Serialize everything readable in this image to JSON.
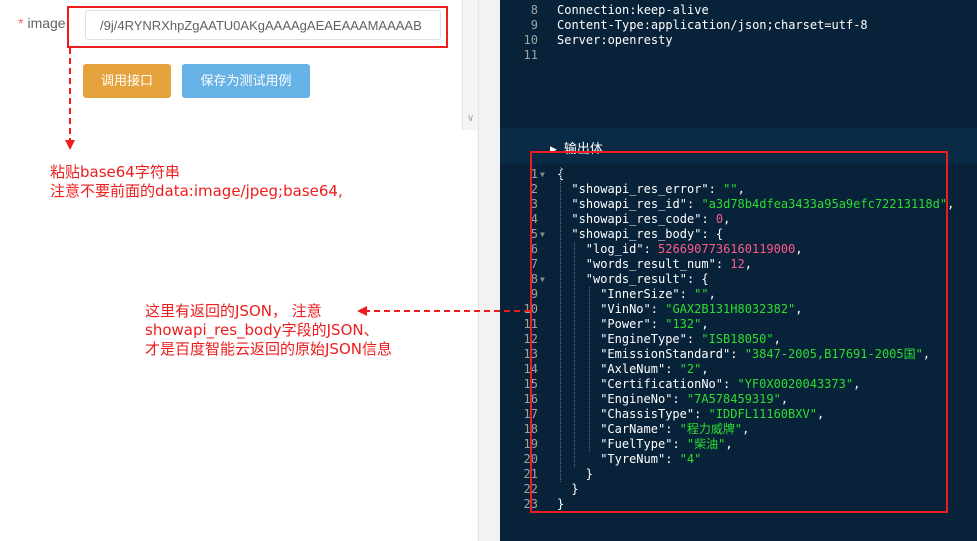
{
  "form": {
    "required_mark": "*",
    "label": "image",
    "input_value": "/9j/4RYNRXhpZgAATU0AKgAAAAgAEAEAAAMAAAAB"
  },
  "buttons": {
    "call": "调用接口",
    "save": "保存为测试用例"
  },
  "annotations": {
    "paste_line1": "粘贴base64字符串",
    "paste_line2": "注意不要前面的data:image/jpeg;base64,",
    "json_line1": "这里有返回的JSON， 注意",
    "json_line2": "showapi_res_body字段的JSON、",
    "json_line3": "才是百度智能云返回的原始JSON信息"
  },
  "colors": {
    "annotation_red": "#ee1c1c",
    "call_button": "#e6a23c",
    "save_button": "#66b1e6",
    "editor_bg": "#072239",
    "json_string": "#2fdc2f",
    "json_number": "#ff5a8a"
  },
  "response_headers": [
    {
      "num": "8",
      "text": "Connection:keep-alive"
    },
    {
      "num": "9",
      "text": "Content-Type:application/json;charset=utf-8"
    },
    {
      "num": "10",
      "text": "Server:openresty"
    },
    {
      "num": "11",
      "text": ""
    }
  ],
  "output_title": "输出体",
  "json_lines": [
    {
      "num": "1",
      "fold": true,
      "indent": 0,
      "parts": [
        [
          "p",
          "{"
        ]
      ]
    },
    {
      "num": "2",
      "fold": false,
      "indent": 1,
      "parts": [
        [
          "k",
          "\"showapi_res_error\""
        ],
        [
          "p",
          ": "
        ],
        [
          "s",
          "\"\""
        ],
        [
          "p",
          ","
        ]
      ]
    },
    {
      "num": "3",
      "fold": false,
      "indent": 1,
      "parts": [
        [
          "k",
          "\"showapi_res_id\""
        ],
        [
          "p",
          ": "
        ],
        [
          "s",
          "\"a3d78b4dfea3433a95a9efc72213118d\""
        ],
        [
          "p",
          ","
        ]
      ]
    },
    {
      "num": "4",
      "fold": false,
      "indent": 1,
      "parts": [
        [
          "k",
          "\"showapi_res_code\""
        ],
        [
          "p",
          ": "
        ],
        [
          "n",
          "0"
        ],
        [
          "p",
          ","
        ]
      ]
    },
    {
      "num": "5",
      "fold": true,
      "indent": 1,
      "parts": [
        [
          "k",
          "\"showapi_res_body\""
        ],
        [
          "p",
          ": {"
        ]
      ]
    },
    {
      "num": "6",
      "fold": false,
      "indent": 2,
      "parts": [
        [
          "k",
          "\"log_id\""
        ],
        [
          "p",
          ": "
        ],
        [
          "n",
          "5266907736160119000"
        ],
        [
          "p",
          ","
        ]
      ]
    },
    {
      "num": "7",
      "fold": false,
      "indent": 2,
      "parts": [
        [
          "k",
          "\"words_result_num\""
        ],
        [
          "p",
          ": "
        ],
        [
          "n",
          "12"
        ],
        [
          "p",
          ","
        ]
      ]
    },
    {
      "num": "8",
      "fold": true,
      "indent": 2,
      "parts": [
        [
          "k",
          "\"words_result\""
        ],
        [
          "p",
          ": {"
        ]
      ]
    },
    {
      "num": "9",
      "fold": false,
      "indent": 3,
      "parts": [
        [
          "k",
          "\"InnerSize\""
        ],
        [
          "p",
          ": "
        ],
        [
          "s",
          "\"\""
        ],
        [
          "p",
          ","
        ]
      ]
    },
    {
      "num": "10",
      "fold": false,
      "indent": 3,
      "parts": [
        [
          "k",
          "\"VinNo\""
        ],
        [
          "p",
          ": "
        ],
        [
          "s",
          "\"GAX2B131H8032382\""
        ],
        [
          "p",
          ","
        ]
      ]
    },
    {
      "num": "11",
      "fold": false,
      "indent": 3,
      "parts": [
        [
          "k",
          "\"Power\""
        ],
        [
          "p",
          ": "
        ],
        [
          "s",
          "\"132\""
        ],
        [
          "p",
          ","
        ]
      ]
    },
    {
      "num": "12",
      "fold": false,
      "indent": 3,
      "parts": [
        [
          "k",
          "\"EngineType\""
        ],
        [
          "p",
          ": "
        ],
        [
          "s",
          "\"ISB18050\""
        ],
        [
          "p",
          ","
        ]
      ]
    },
    {
      "num": "13",
      "fold": false,
      "indent": 3,
      "parts": [
        [
          "k",
          "\"EmissionStandard\""
        ],
        [
          "p",
          ": "
        ],
        [
          "s",
          "\"3847-2005,B17691-2005国\""
        ],
        [
          "p",
          ","
        ]
      ]
    },
    {
      "num": "14",
      "fold": false,
      "indent": 3,
      "parts": [
        [
          "k",
          "\"AxleNum\""
        ],
        [
          "p",
          ": "
        ],
        [
          "s",
          "\"2\""
        ],
        [
          "p",
          ","
        ]
      ]
    },
    {
      "num": "15",
      "fold": false,
      "indent": 3,
      "parts": [
        [
          "k",
          "\"CertificationNo\""
        ],
        [
          "p",
          ": "
        ],
        [
          "s",
          "\"YF0X0020043373\""
        ],
        [
          "p",
          ","
        ]
      ]
    },
    {
      "num": "16",
      "fold": false,
      "indent": 3,
      "parts": [
        [
          "k",
          "\"EngineNo\""
        ],
        [
          "p",
          ": "
        ],
        [
          "s",
          "\"7A578459319\""
        ],
        [
          "p",
          ","
        ]
      ]
    },
    {
      "num": "17",
      "fold": false,
      "indent": 3,
      "parts": [
        [
          "k",
          "\"ChassisType\""
        ],
        [
          "p",
          ": "
        ],
        [
          "s",
          "\"IDDFL11160BXV\""
        ],
        [
          "p",
          ","
        ]
      ]
    },
    {
      "num": "18",
      "fold": false,
      "indent": 3,
      "parts": [
        [
          "k",
          "\"CarName\""
        ],
        [
          "p",
          ": "
        ],
        [
          "s",
          "\"程力威牌\""
        ],
        [
          "p",
          ","
        ]
      ]
    },
    {
      "num": "19",
      "fold": false,
      "indent": 3,
      "parts": [
        [
          "k",
          "\"FuelType\""
        ],
        [
          "p",
          ": "
        ],
        [
          "s",
          "\"柴油\""
        ],
        [
          "p",
          ","
        ]
      ]
    },
    {
      "num": "20",
      "fold": false,
      "indent": 3,
      "parts": [
        [
          "k",
          "\"TyreNum\""
        ],
        [
          "p",
          ": "
        ],
        [
          "s",
          "\"4\""
        ]
      ]
    },
    {
      "num": "21",
      "fold": false,
      "indent": 2,
      "parts": [
        [
          "p",
          "}"
        ]
      ]
    },
    {
      "num": "22",
      "fold": false,
      "indent": 1,
      "parts": [
        [
          "p",
          "}"
        ]
      ]
    },
    {
      "num": "23",
      "fold": false,
      "indent": 0,
      "parts": [
        [
          "p",
          "}"
        ]
      ]
    }
  ]
}
